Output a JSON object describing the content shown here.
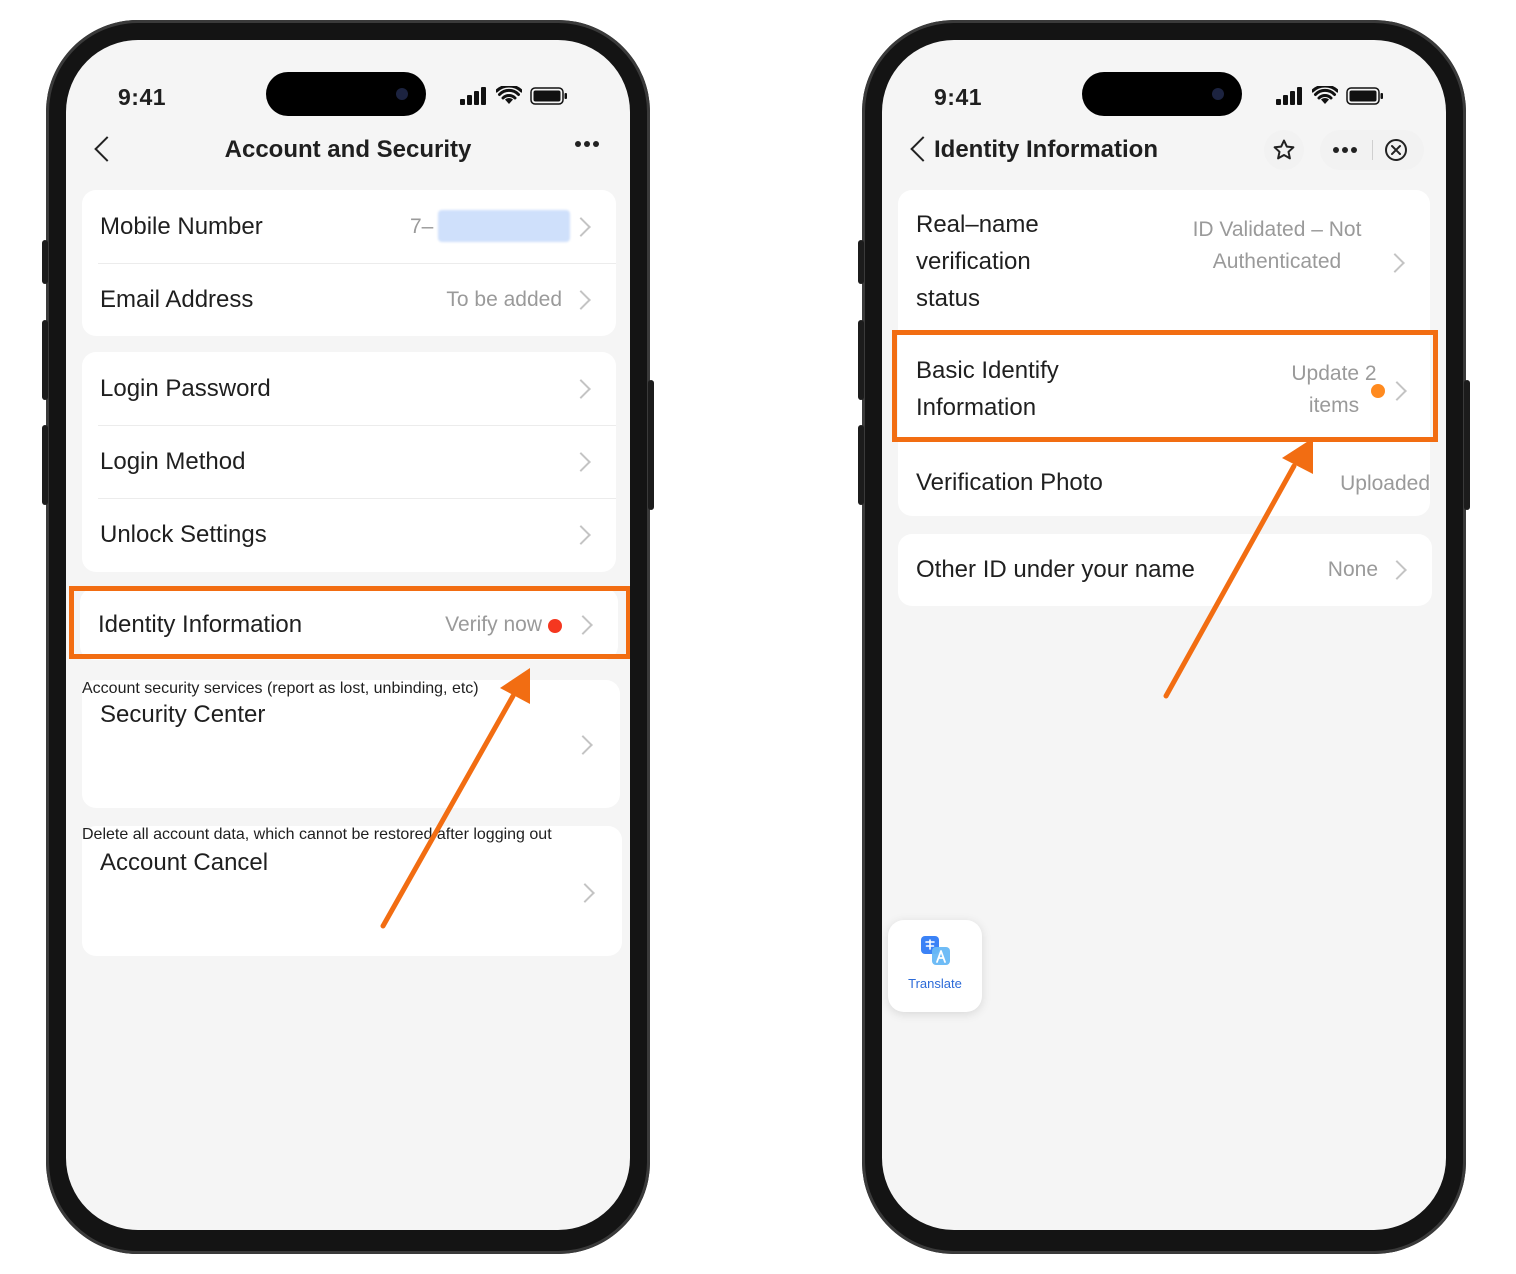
{
  "status_bar": {
    "time": "9:41"
  },
  "left_screen": {
    "title": "Account and Security",
    "rows": {
      "mobile_number": {
        "label": "Mobile Number",
        "value": "7–"
      },
      "email_address": {
        "label": "Email Address",
        "value": "To be added"
      },
      "login_password": {
        "label": "Login Password"
      },
      "login_method": {
        "label": "Login Method"
      },
      "unlock_settings": {
        "label": "Unlock Settings"
      },
      "identity_information": {
        "label": "Identity Information",
        "value": "Verify now"
      },
      "security_center": {
        "label": "Security Center",
        "sub": "Account security services (report as lost, unbinding, etc)"
      },
      "account_cancel": {
        "label": "Account Cancel",
        "sub": "Delete all account data, which cannot be restored after logging out"
      }
    }
  },
  "right_screen": {
    "title": "Identity Information",
    "rows": {
      "real_name": {
        "label": "Real–name verification status",
        "value": "ID Validated – Not Authenticated"
      },
      "basic_identify": {
        "label": "Basic Identify Information",
        "value": "Update 2 items"
      },
      "verification_photo": {
        "label": "Verification Photo",
        "value": "Uploaded"
      },
      "other_id": {
        "label": "Other ID under your name",
        "value": "None"
      }
    },
    "translate_label": "Translate"
  },
  "colors": {
    "highlight": "#f26d12",
    "red_dot": "#f5371f",
    "orange_dot": "#ff8a1f",
    "screen_bg": "#f5f5f5"
  }
}
